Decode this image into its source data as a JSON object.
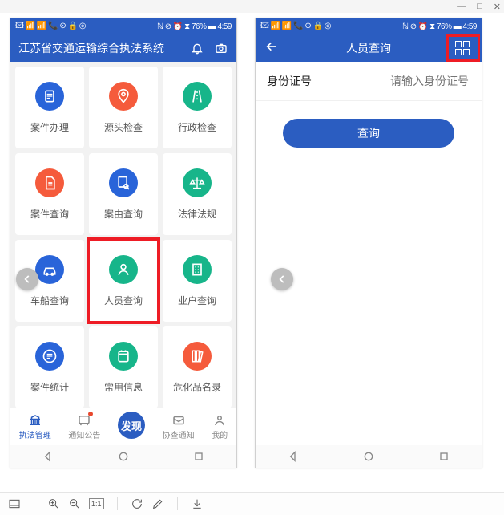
{
  "window": {
    "controls": {
      "minimize": "—",
      "maximize": "□",
      "close": "✕"
    }
  },
  "phoneLeft": {
    "status": {
      "left": "🖾 📶 📶 📞 ⊙ 🔒 ◎ ",
      "right": "ℕ ⊘ ⏰ ⧗ 76% ▬ 4:59"
    },
    "header": {
      "title": "江苏省交通运输综合执法系统"
    },
    "tiles": [
      {
        "label": "案件办理",
        "color": "#2964d9"
      },
      {
        "label": "源头检查",
        "color": "#f55b3c"
      },
      {
        "label": "行政检查",
        "color": "#17b58a"
      },
      {
        "label": "案件查询",
        "color": "#f55b3c"
      },
      {
        "label": "案由查询",
        "color": "#2964d9"
      },
      {
        "label": "法律法规",
        "color": "#17b58a"
      },
      {
        "label": "车船查询",
        "color": "#2964d9"
      },
      {
        "label": "人员查询",
        "color": "#17b58a"
      },
      {
        "label": "业户查询",
        "color": "#17b58a"
      },
      {
        "label": "案件统计",
        "color": "#2964d9"
      },
      {
        "label": "常用信息",
        "color": "#17b58a"
      },
      {
        "label": "危化品名录",
        "color": "#f55b3c"
      }
    ],
    "highlightedTileIndex": 7,
    "bottomNav": {
      "items": [
        {
          "label": "执法管理",
          "active": true
        },
        {
          "label": "通知公告"
        },
        {
          "label": "发现",
          "center": true
        },
        {
          "label": "协查通知"
        },
        {
          "label": "我的"
        }
      ]
    }
  },
  "phoneRight": {
    "status": {
      "left": "🖾 📶 📶 📞 ⊙ 🔒 ◎ ",
      "right": "ℕ ⊘ ⏰ ⧗ 76% ▬ 4:59"
    },
    "header": {
      "title": "人员查询"
    },
    "form": {
      "label": "身份证号",
      "placeholder": "请输入身份证号"
    },
    "queryButton": "查询"
  },
  "toolbar": {
    "scale": "1:1"
  }
}
